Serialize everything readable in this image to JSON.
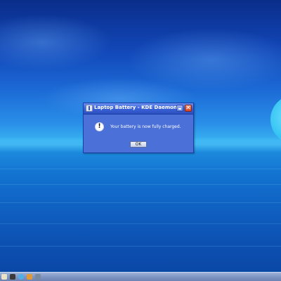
{
  "dialog": {
    "title": "Laptop Battery - KDE Daemon",
    "message": "Your battery is now fully charged.",
    "ok_label": "OK",
    "close_glyph": "✕",
    "warn_glyph": "!"
  },
  "taskbar": {
    "icons": [
      "kde-menu-icon",
      "terminal-icon",
      "konqueror-icon",
      "mail-icon",
      "settings-icon"
    ]
  },
  "colors": {
    "titlebar": "#3b62d6",
    "dialog_body": "#4b70d8",
    "close_button": "#d9441e",
    "taskbar": "#7f95c2"
  }
}
